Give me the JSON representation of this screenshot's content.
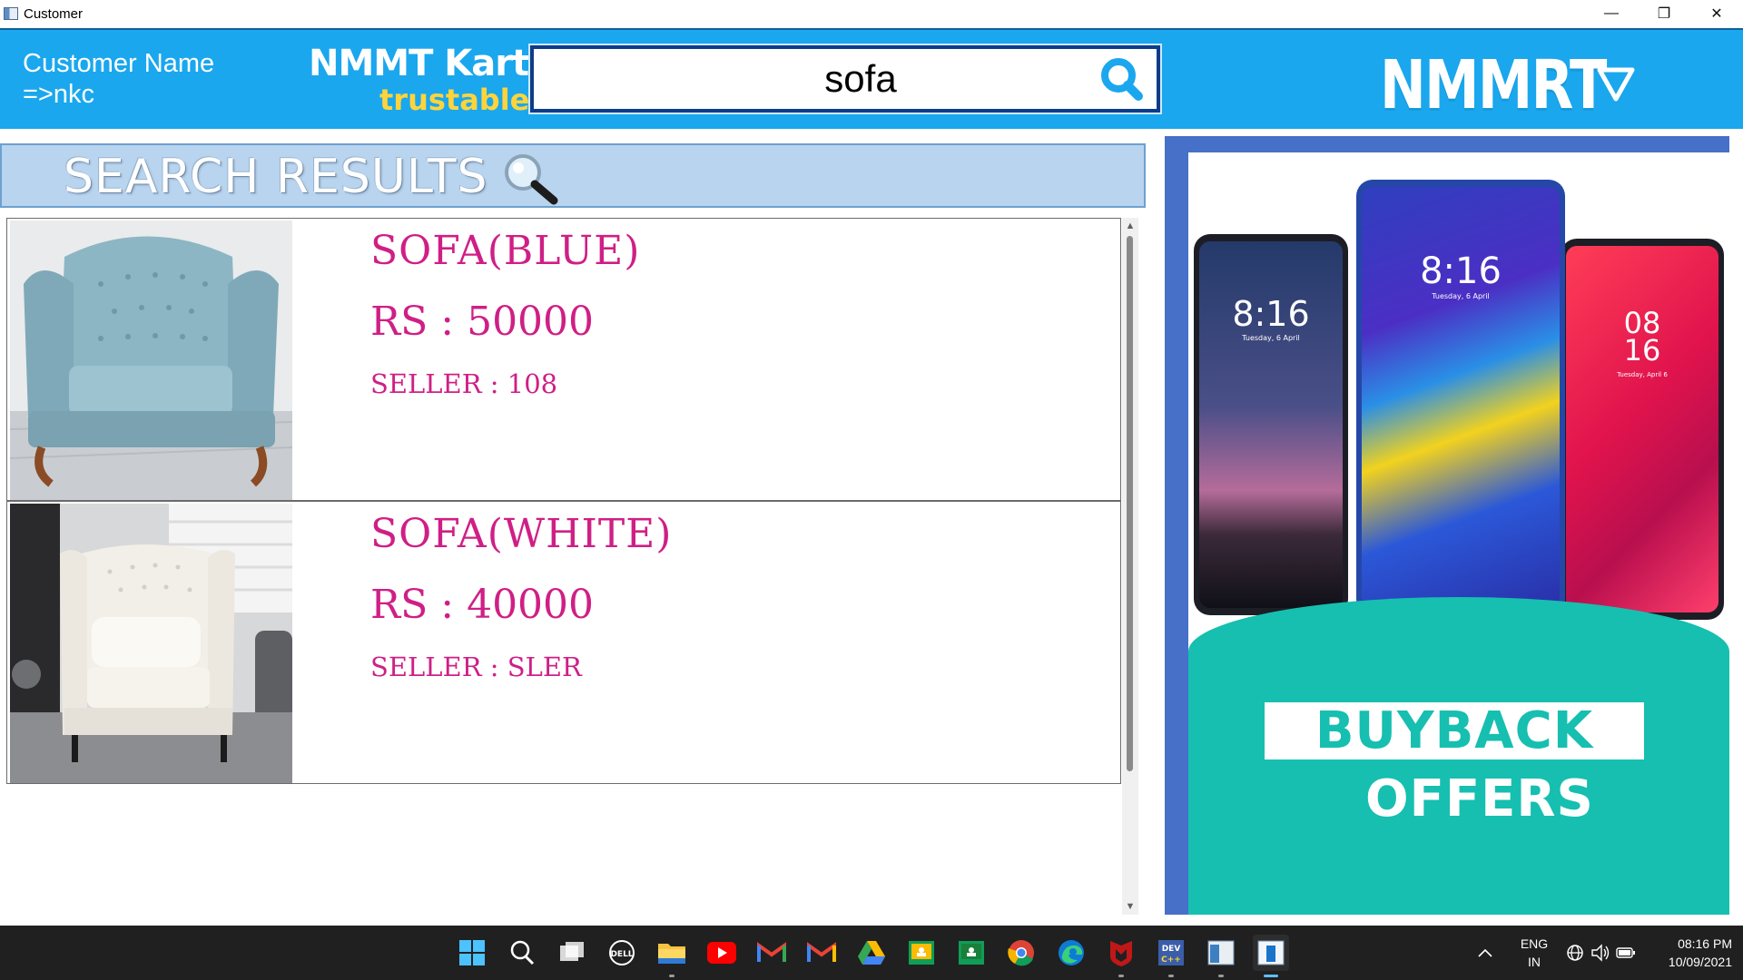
{
  "window": {
    "title": "Customer",
    "minimize_glyph": "—",
    "restore_glyph": "❐",
    "close_glyph": "✕"
  },
  "header": {
    "customer_label": "Customer Name",
    "customer_name": "=>nkc",
    "brand_name": "NMMT Kart",
    "brand_tagline": "trustable",
    "search_value": "sofa",
    "logo_text": "NMMRT",
    "accent_color": "#1aa7ee"
  },
  "results": {
    "title": "SEARCH RESULTS",
    "items": [
      {
        "name": "SOFA(BLUE)",
        "price": "RS : 50000",
        "seller": "SELLER : 108"
      },
      {
        "name": "SOFA(WHITE)",
        "price": "RS : 40000",
        "seller": "SELLER : SLER"
      }
    ]
  },
  "ad": {
    "line1": "BUYBACK",
    "line2": "OFFERS",
    "phones": [
      {
        "time": "8:16",
        "date": "Tuesday, 6 April"
      },
      {
        "time": "8:16",
        "date": "Tuesday, 6 April"
      },
      {
        "time": "08\n16",
        "date": "Tuesday, April 6"
      }
    ]
  },
  "taskbar": {
    "icons": [
      "windows-start-icon",
      "search-icon",
      "task-view-icon",
      "dell-icon",
      "file-explorer-icon",
      "youtube-icon",
      "gmail-icon",
      "gmail-icon-2",
      "google-drive-icon",
      "classroom-icon",
      "classroom-icon-2",
      "chrome-icon",
      "edge-icon",
      "mcafee-icon",
      "dev-cpp-icon",
      "app-window-icon",
      "customer-app-icon"
    ],
    "lang_line1": "ENG",
    "lang_line2": "IN",
    "time": "08:16 PM",
    "date": "10/09/2021"
  }
}
